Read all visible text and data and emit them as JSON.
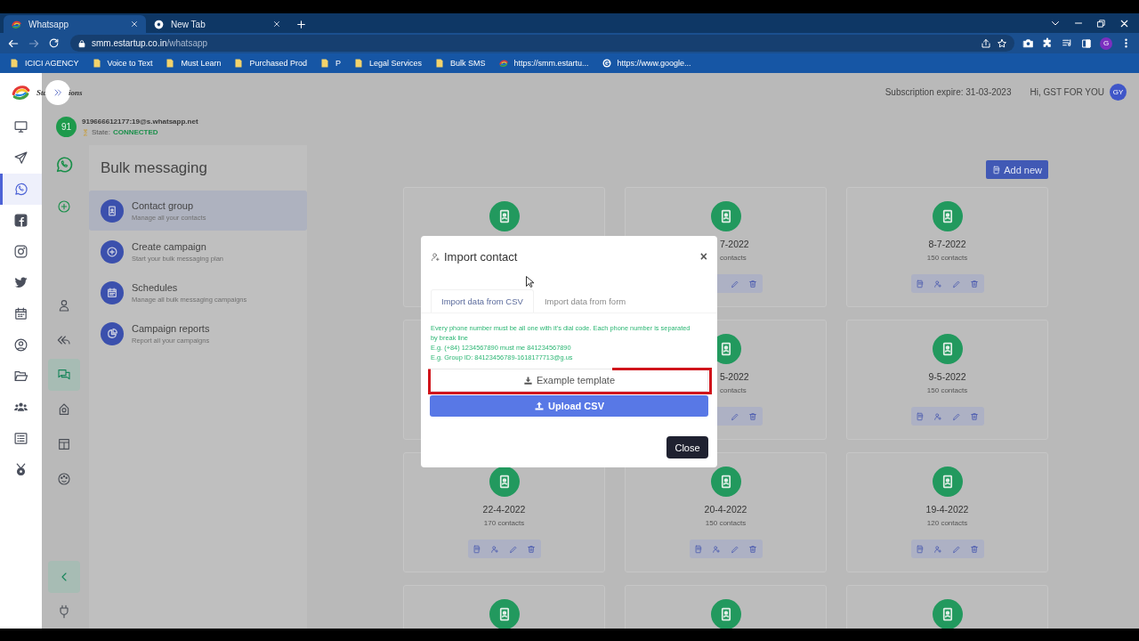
{
  "browser": {
    "tabs": [
      {
        "title": "Whatsapp",
        "selected": true
      },
      {
        "title": "New Tab",
        "selected": false
      }
    ],
    "address": {
      "host": "smm.estartup.co.in",
      "path": "/whatsapp"
    },
    "bookmarks": [
      {
        "kind": "folder",
        "label": "ICICI AGENCY"
      },
      {
        "kind": "folder",
        "label": "Voice to Text"
      },
      {
        "kind": "folder",
        "label": "Must Learn"
      },
      {
        "kind": "folder",
        "label": "Purchased Prod"
      },
      {
        "kind": "folder",
        "label": "P"
      },
      {
        "kind": "folder",
        "label": "Legal Services"
      },
      {
        "kind": "folder",
        "label": "Bulk SMS"
      },
      {
        "kind": "site",
        "label": "https://smm.estartu..."
      },
      {
        "kind": "google",
        "label": "https://www.google..."
      }
    ],
    "profile": "G"
  },
  "header": {
    "logo_parts": [
      "Sta",
      "ions"
    ],
    "subscription": "Subscription expire: 31-03-2023",
    "greeting": "Hi, GST FOR YOU",
    "avatar": "GY"
  },
  "account": {
    "avatar": "91",
    "id": "919666612177:19@s.whatsapp.net",
    "state_label": "State:",
    "state": "CONNECTED"
  },
  "rail": [
    {
      "selected": false
    },
    {
      "selected": false
    },
    {
      "selected": true
    },
    {
      "selected": false
    },
    {
      "selected": false
    },
    {
      "selected": false
    },
    {
      "selected": false
    },
    {
      "selected": false
    },
    {
      "selected": false
    },
    {
      "selected": false
    },
    {
      "selected": false
    },
    {
      "selected": false
    }
  ],
  "sub_rail": {
    "top_items": [
      {
        "selected": false
      },
      {
        "selected": false
      }
    ],
    "middle_items": [
      {
        "selected": false
      },
      {
        "selected": false
      },
      {
        "selected": true
      },
      {
        "selected": false
      },
      {
        "selected": false
      },
      {
        "selected": false
      }
    ],
    "bottom_items": [
      {
        "selected": true
      },
      {
        "selected": false
      }
    ]
  },
  "panel": {
    "title": "Bulk messaging",
    "items": [
      {
        "title": "Contact group",
        "subtitle": "Manage all your contacts",
        "selected": true
      },
      {
        "title": "Create campaign",
        "subtitle": "Start your bulk messaging plan",
        "selected": false
      },
      {
        "title": "Schedules",
        "subtitle": "Manage all bulk messaging campaigns",
        "selected": false
      },
      {
        "title": "Campaign reports",
        "subtitle": "Report all your campaigns",
        "selected": false
      }
    ]
  },
  "add_button": "Add new",
  "cards": [
    {
      "kind": "icon"
    },
    {
      "kind": "covered",
      "date": "7-2022",
      "contacts": "contacts"
    },
    {
      "kind": "group",
      "date": "8-7-2022",
      "contacts": "150 contacts"
    },
    {
      "kind": "blank"
    },
    {
      "kind": "covered",
      "date": "5-2022",
      "contacts": "contacts"
    },
    {
      "kind": "group",
      "date": "9-5-2022",
      "contacts": "150 contacts"
    },
    {
      "kind": "group",
      "date": "22-4-2022",
      "contacts": "170 contacts"
    },
    {
      "kind": "group",
      "date": "20-4-2022",
      "contacts": "150 contacts"
    },
    {
      "kind": "group",
      "date": "19-4-2022",
      "contacts": "120 contacts"
    },
    {
      "kind": "icon"
    },
    {
      "kind": "icon"
    },
    {
      "kind": "icon"
    }
  ],
  "modal": {
    "title": "Import contact",
    "close_icon": "×",
    "tabs": [
      {
        "label": "Import data from CSV",
        "selected": true
      },
      {
        "label": "Import data from form",
        "selected": false
      }
    ],
    "info": [
      "Every phone number must be all one with it's dial code. Each phone number is separated by break line",
      "E.g. (+84) 1234567890 must me 841234567890",
      "E.g. Group ID: 84123456789-1618177713@g.us"
    ],
    "template_button": "Example template",
    "upload_button": "Upload CSV",
    "close_button": "Close"
  }
}
